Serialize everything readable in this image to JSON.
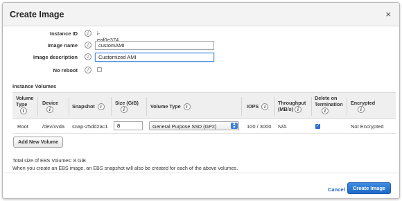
{
  "dialog": {
    "title": "Create Image",
    "close_glyph": "×"
  },
  "form": {
    "instance_id": {
      "label": "Instance ID",
      "value": "i-eaf0e374"
    },
    "image_name": {
      "label": "Image name",
      "value": "customAMI",
      "placeholder": ""
    },
    "image_description": {
      "label": "Image description",
      "value": "Customized AMI",
      "placeholder": ""
    },
    "no_reboot": {
      "label": "No reboot",
      "checked": false
    }
  },
  "info_glyph": "i",
  "volumes": {
    "section_title": "Instance Volumes",
    "headers": {
      "volume_type": "Volume Type",
      "device": "Device",
      "snapshot": "Snapshot",
      "size": "Size (GiB)",
      "vol_type": "Volume Type",
      "iops": "IOPS",
      "throughput": "Throughput (MB/s)",
      "delete_on_termination": "Delete on Termination",
      "encrypted": "Encrypted"
    },
    "row": {
      "type": "Root",
      "device": "/dev/xvda",
      "snapshot": "snap-25dd2ac1",
      "size": "8",
      "volume_type": "General Purpose SSD (GP2)",
      "iops": "100 / 3000",
      "throughput": "N/A",
      "delete_on_termination": true,
      "encrypted": "Not Encrypted"
    },
    "add_button": "Add New Volume"
  },
  "notes": {
    "total_size": "Total size of EBS Volumes: 8 GiB",
    "snapshot_note": "When you create an EBS image, an EBS snapshot will also be created for each of the above volumes."
  },
  "footer": {
    "cancel": "Cancel",
    "create": "Create Image"
  },
  "colors": {
    "primary": "#1f6ac7",
    "link": "#1a64c8",
    "header_bg": "#f3f3f3"
  }
}
